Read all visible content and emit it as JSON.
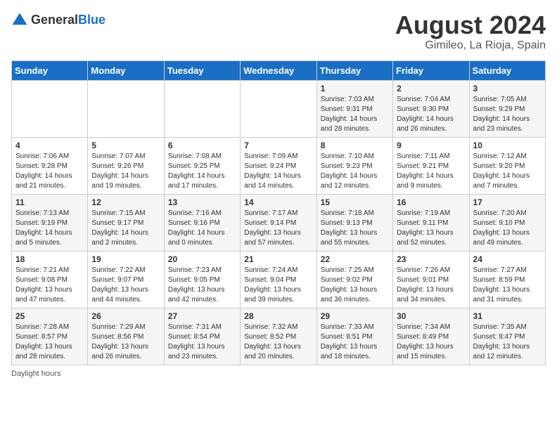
{
  "header": {
    "logo_general": "General",
    "logo_blue": "Blue",
    "month_year": "August 2024",
    "location": "Gimileo, La Rioja, Spain"
  },
  "days_of_week": [
    "Sunday",
    "Monday",
    "Tuesday",
    "Wednesday",
    "Thursday",
    "Friday",
    "Saturday"
  ],
  "weeks": [
    [
      {
        "day": "",
        "info": ""
      },
      {
        "day": "",
        "info": ""
      },
      {
        "day": "",
        "info": ""
      },
      {
        "day": "",
        "info": ""
      },
      {
        "day": "1",
        "info": "Sunrise: 7:03 AM\nSunset: 9:31 PM\nDaylight: 14 hours\nand 28 minutes."
      },
      {
        "day": "2",
        "info": "Sunrise: 7:04 AM\nSunset: 9:30 PM\nDaylight: 14 hours\nand 26 minutes."
      },
      {
        "day": "3",
        "info": "Sunrise: 7:05 AM\nSunset: 9:29 PM\nDaylight: 14 hours\nand 23 minutes."
      }
    ],
    [
      {
        "day": "4",
        "info": "Sunrise: 7:06 AM\nSunset: 9:28 PM\nDaylight: 14 hours\nand 21 minutes."
      },
      {
        "day": "5",
        "info": "Sunrise: 7:07 AM\nSunset: 9:26 PM\nDaylight: 14 hours\nand 19 minutes."
      },
      {
        "day": "6",
        "info": "Sunrise: 7:08 AM\nSunset: 9:25 PM\nDaylight: 14 hours\nand 17 minutes."
      },
      {
        "day": "7",
        "info": "Sunrise: 7:09 AM\nSunset: 9:24 PM\nDaylight: 14 hours\nand 14 minutes."
      },
      {
        "day": "8",
        "info": "Sunrise: 7:10 AM\nSunset: 9:23 PM\nDaylight: 14 hours\nand 12 minutes."
      },
      {
        "day": "9",
        "info": "Sunrise: 7:11 AM\nSunset: 9:21 PM\nDaylight: 14 hours\nand 9 minutes."
      },
      {
        "day": "10",
        "info": "Sunrise: 7:12 AM\nSunset: 9:20 PM\nDaylight: 14 hours\nand 7 minutes."
      }
    ],
    [
      {
        "day": "11",
        "info": "Sunrise: 7:13 AM\nSunset: 9:19 PM\nDaylight: 14 hours\nand 5 minutes."
      },
      {
        "day": "12",
        "info": "Sunrise: 7:15 AM\nSunset: 9:17 PM\nDaylight: 14 hours\nand 2 minutes."
      },
      {
        "day": "13",
        "info": "Sunrise: 7:16 AM\nSunset: 9:16 PM\nDaylight: 14 hours\nand 0 minutes."
      },
      {
        "day": "14",
        "info": "Sunrise: 7:17 AM\nSunset: 9:14 PM\nDaylight: 13 hours\nand 57 minutes."
      },
      {
        "day": "15",
        "info": "Sunrise: 7:18 AM\nSunset: 9:13 PM\nDaylight: 13 hours\nand 55 minutes."
      },
      {
        "day": "16",
        "info": "Sunrise: 7:19 AM\nSunset: 9:11 PM\nDaylight: 13 hours\nand 52 minutes."
      },
      {
        "day": "17",
        "info": "Sunrise: 7:20 AM\nSunset: 9:10 PM\nDaylight: 13 hours\nand 49 minutes."
      }
    ],
    [
      {
        "day": "18",
        "info": "Sunrise: 7:21 AM\nSunset: 9:08 PM\nDaylight: 13 hours\nand 47 minutes."
      },
      {
        "day": "19",
        "info": "Sunrise: 7:22 AM\nSunset: 9:07 PM\nDaylight: 13 hours\nand 44 minutes."
      },
      {
        "day": "20",
        "info": "Sunrise: 7:23 AM\nSunset: 9:05 PM\nDaylight: 13 hours\nand 42 minutes."
      },
      {
        "day": "21",
        "info": "Sunrise: 7:24 AM\nSunset: 9:04 PM\nDaylight: 13 hours\nand 39 minutes."
      },
      {
        "day": "22",
        "info": "Sunrise: 7:25 AM\nSunset: 9:02 PM\nDaylight: 13 hours\nand 36 minutes."
      },
      {
        "day": "23",
        "info": "Sunrise: 7:26 AM\nSunset: 9:01 PM\nDaylight: 13 hours\nand 34 minutes."
      },
      {
        "day": "24",
        "info": "Sunrise: 7:27 AM\nSunset: 8:59 PM\nDaylight: 13 hours\nand 31 minutes."
      }
    ],
    [
      {
        "day": "25",
        "info": "Sunrise: 7:28 AM\nSunset: 8:57 PM\nDaylight: 13 hours\nand 28 minutes."
      },
      {
        "day": "26",
        "info": "Sunrise: 7:29 AM\nSunset: 8:56 PM\nDaylight: 13 hours\nand 26 minutes."
      },
      {
        "day": "27",
        "info": "Sunrise: 7:31 AM\nSunset: 8:54 PM\nDaylight: 13 hours\nand 23 minutes."
      },
      {
        "day": "28",
        "info": "Sunrise: 7:32 AM\nSunset: 8:52 PM\nDaylight: 13 hours\nand 20 minutes."
      },
      {
        "day": "29",
        "info": "Sunrise: 7:33 AM\nSunset: 8:51 PM\nDaylight: 13 hours\nand 18 minutes."
      },
      {
        "day": "30",
        "info": "Sunrise: 7:34 AM\nSunset: 8:49 PM\nDaylight: 13 hours\nand 15 minutes."
      },
      {
        "day": "31",
        "info": "Sunrise: 7:35 AM\nSunset: 8:47 PM\nDaylight: 13 hours\nand 12 minutes."
      }
    ]
  ],
  "footer": {
    "daylight_label": "Daylight hours"
  }
}
